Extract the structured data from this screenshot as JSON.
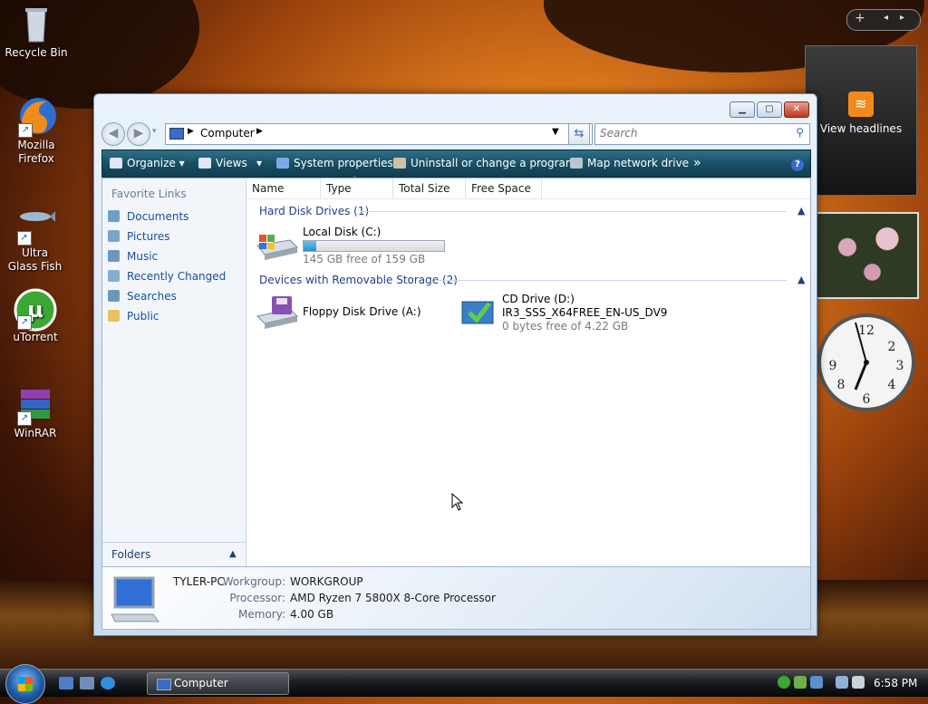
{
  "desktop": {
    "icons": [
      {
        "label": "Recycle Bin"
      },
      {
        "label": "Mozilla Firefox"
      },
      {
        "label": "Ultra Glass Fish"
      },
      {
        "label": "uTorrent"
      },
      {
        "label": "WinRAR"
      }
    ]
  },
  "gadgets": {
    "feed_label": "View headlines",
    "add_symbol": "+"
  },
  "window": {
    "address": {
      "crumb": "Computer"
    },
    "search": {
      "placeholder": "Search"
    },
    "toolbar": {
      "organize": "Organize",
      "views": "Views",
      "system_properties": "System properties",
      "uninstall": "Uninstall or change a program",
      "map_drive": "Map network drive",
      "overflow": "»",
      "help": "?"
    },
    "nav": {
      "header": "Favorite Links",
      "links": [
        "Documents",
        "Pictures",
        "Music",
        "Recently Changed",
        "Searches",
        "Public"
      ],
      "folders": "Folders"
    },
    "columns": [
      "Name",
      "Type",
      "Total Size",
      "Free Space"
    ],
    "groups": {
      "hdd": {
        "title": "Hard Disk Drives (1)",
        "items": [
          {
            "name": "Local Disk (C:)",
            "free": "145 GB free of 159 GB",
            "used_fraction": 0.09
          }
        ]
      },
      "removable": {
        "title": "Devices with Removable Storage (2)",
        "items": [
          {
            "name": "Floppy Disk Drive (A:)"
          },
          {
            "name": "CD Drive (D:)",
            "label": "IR3_SSS_X64FREE_EN-US_DV9",
            "free": "0 bytes free of 4.22 GB"
          }
        ]
      }
    },
    "details": {
      "computer_name": "TYLER-PC",
      "workgroup_label": "Workgroup:",
      "workgroup": "WORKGROUP",
      "processor_label": "Processor:",
      "processor": "AMD Ryzen 7 5800X 8-Core Processor",
      "memory_label": "Memory:",
      "memory": "4.00 GB"
    }
  },
  "taskbar": {
    "task": "Computer",
    "time": "6:58 PM"
  },
  "colors": {
    "toolbar": "#174d63",
    "link": "#1a4fa0",
    "group_header": "#1f3f8f",
    "close_button": "#c0361f"
  }
}
